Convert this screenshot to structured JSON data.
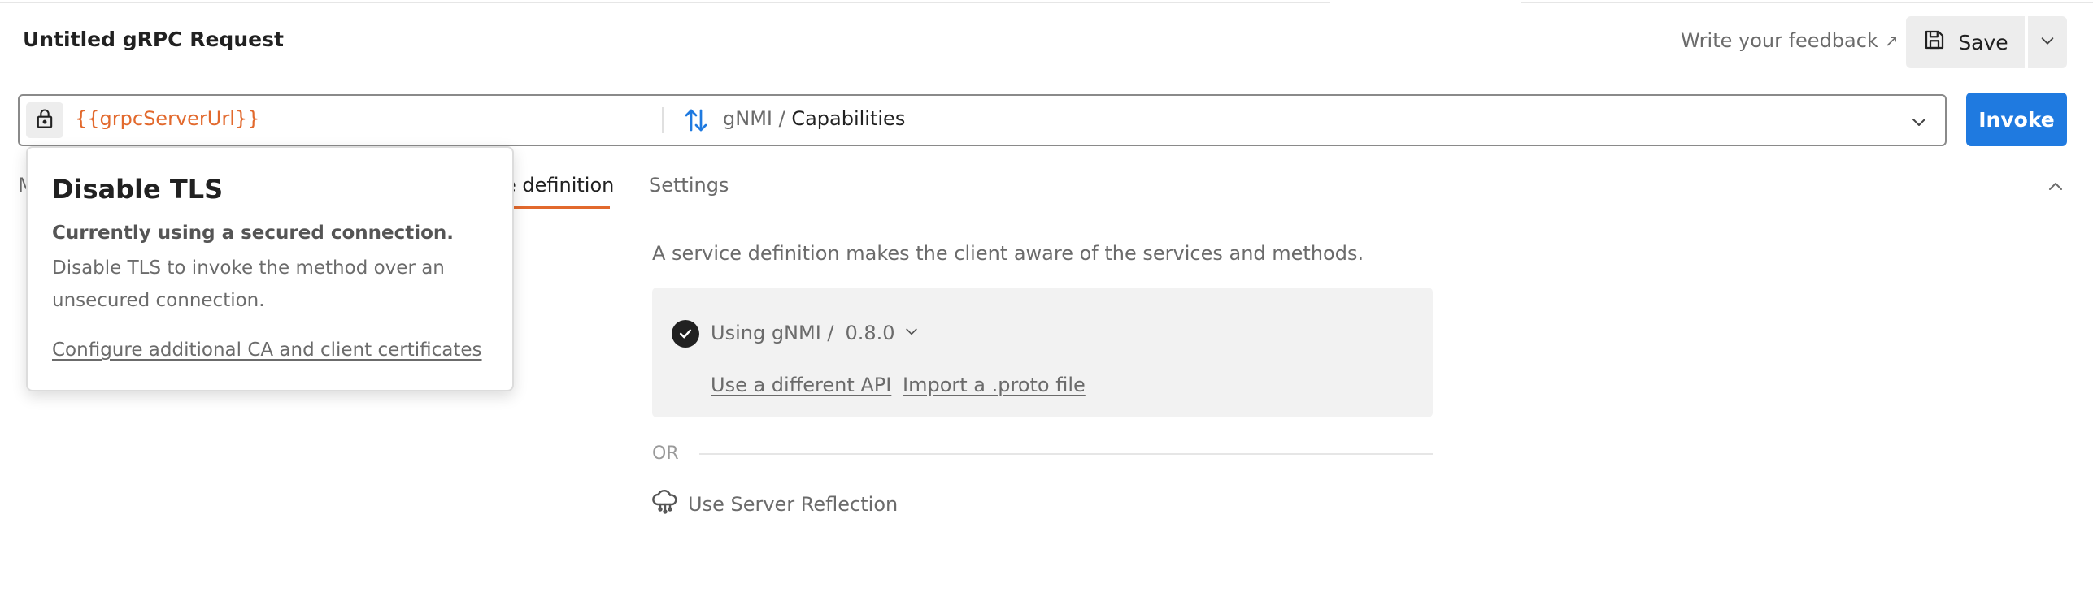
{
  "request": {
    "title": "Untitled gRPC Request"
  },
  "header": {
    "feedback_label": "Write your feedback",
    "feedback_arrow": "↗",
    "save_label": "Save"
  },
  "urlbar": {
    "url": "{{grpcServerUrl}}",
    "service": "gNMI",
    "separator": " / ",
    "method": "Capabilities",
    "invoke_label": "Invoke"
  },
  "tabs": [
    {
      "label": "M"
    },
    {
      "label": "e definition"
    },
    {
      "label": "Settings"
    }
  ],
  "service_definition": {
    "description": "A service definition makes the client aware of the services and methods.",
    "using_label": "Using gNMI /",
    "version": "0.8.0",
    "link_api": "Use a different API",
    "link_proto": "Import a .proto file",
    "or_label": "OR",
    "reflection_label": "Use Server Reflection"
  },
  "tls_popover": {
    "title": "Disable TLS",
    "strong_text": "Currently using a secured connection.",
    "body": "Disable TLS to invoke the method over an unsecured connection.",
    "link": "Configure additional CA and client certificates"
  },
  "colors": {
    "accent_orange": "#e2692d",
    "primary_blue": "#1f7ae0",
    "text_dark": "#212121",
    "text_muted": "#6b6b6b"
  }
}
